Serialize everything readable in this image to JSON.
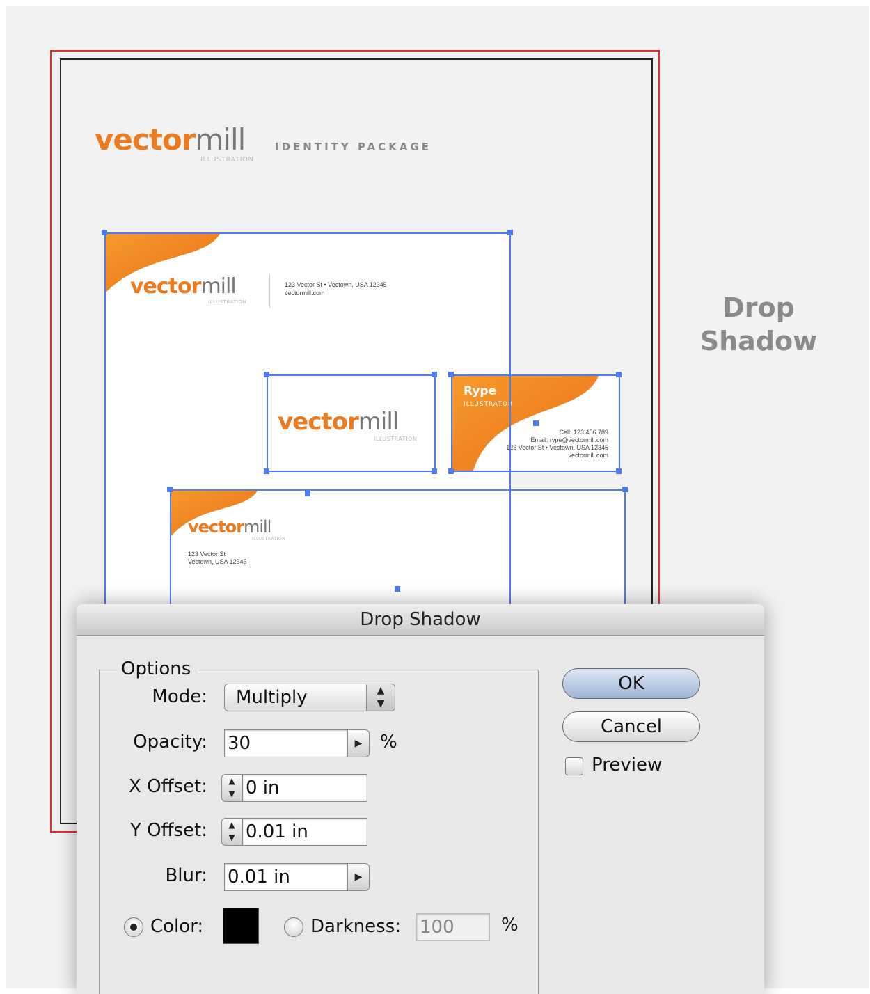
{
  "document": {
    "logo_vector": "vector",
    "logo_mill": "mill",
    "logo_subtitle": "ILLUSTRATION",
    "identity_label": "IDENTITY PACKAGE",
    "letterhead_address": "123 Vector St • Vectown, USA 12345",
    "letterhead_web": "vectormill.com",
    "card_name": "Rype",
    "card_title": "ILLUSTRATOR",
    "card_cell": "Cell: 123.456.789",
    "card_email": "Email: rype@vectormill.com",
    "card_address": "123 Vector St • Vectown, USA 12345",
    "card_web": "vectormill.com",
    "envelope_address_1": "123 Vector St",
    "envelope_address_2": "Vectown, USA 12345",
    "brand_orange": "#ee7a1f",
    "selection_color": "#4f7cf0"
  },
  "side_title": {
    "line1": "Drop",
    "line2": "Shadow"
  },
  "dialog": {
    "title": "Drop Shadow",
    "options_legend": "Options",
    "mode_label": "Mode:",
    "mode_value": "Multiply",
    "opacity_label": "Opacity:",
    "opacity_value": "30",
    "percent_symbol": "%",
    "x_offset_label": "X Offset:",
    "x_offset_value": "0 in",
    "y_offset_label": "Y Offset:",
    "y_offset_value": "0.01 in",
    "blur_label": "Blur:",
    "blur_value": "0.01 in",
    "color_label": "Color:",
    "color_value": "#000000",
    "darkness_label": "Darkness:",
    "darkness_value": "100",
    "ok_label": "OK",
    "cancel_label": "Cancel",
    "preview_label": "Preview"
  }
}
